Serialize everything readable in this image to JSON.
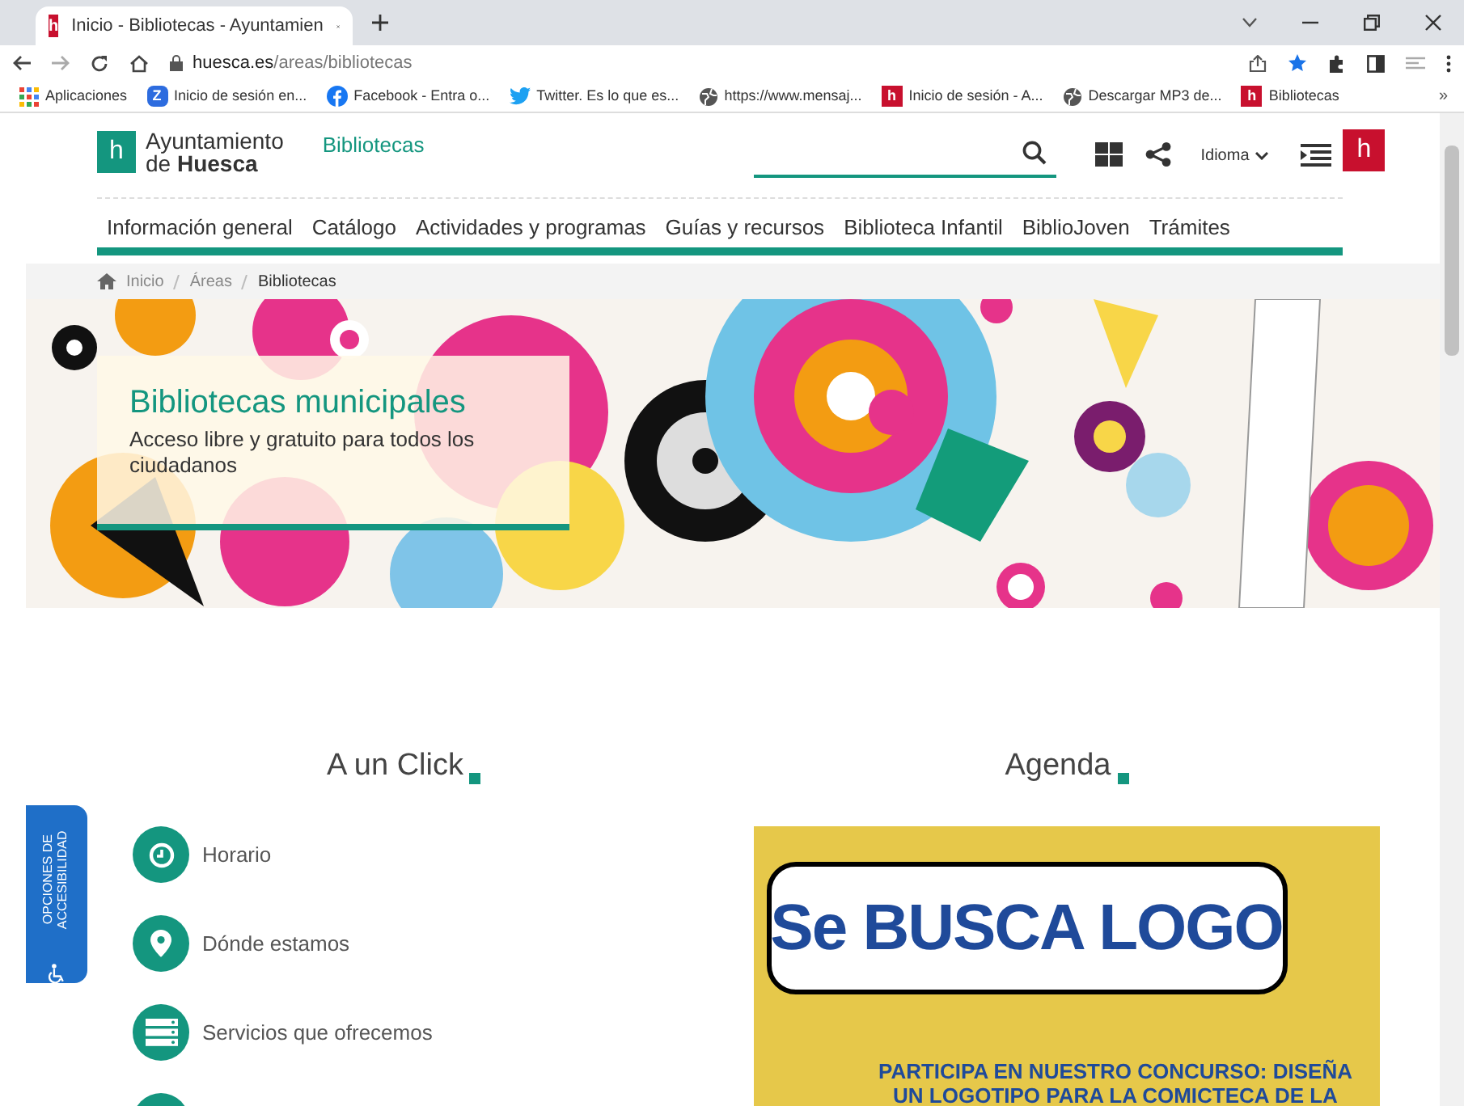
{
  "browser": {
    "tabs": [
      {
        "title": "Inicio - Bibliotecas - Ayuntamien",
        "favicon": "h",
        "selected": true
      }
    ],
    "url": {
      "host": "huesca.es",
      "path": "/areas/bibliotecas"
    },
    "bookmarks": [
      {
        "label": "Aplicaciones",
        "kind": "apps"
      },
      {
        "label": "Inicio de sesión en...",
        "kind": "letter",
        "favicon": "Z"
      },
      {
        "label": "Facebook - Entra o...",
        "kind": "facebook"
      },
      {
        "label": "Twitter. Es lo que es...",
        "kind": "twitter"
      },
      {
        "label": "https://www.mensaj...",
        "kind": "globe"
      },
      {
        "label": "Inicio de sesión - A...",
        "kind": "h",
        "favicon": "h"
      },
      {
        "label": "Descargar MP3 de...",
        "kind": "globe"
      },
      {
        "label": "Bibliotecas",
        "kind": "h",
        "favicon": "h"
      }
    ],
    "more": "»"
  },
  "site": {
    "logo": {
      "mark": "h",
      "line1": "Ayuntamiento",
      "line2_prefix": "de",
      "line2": "Huesca"
    },
    "section": "Bibliotecas",
    "language": "Idioma",
    "city_logo": "h",
    "nav": [
      "Información general",
      "Catálogo",
      "Actividades y programas",
      "Guías y recursos",
      "Biblioteca Infantil",
      "BiblioJoven",
      "Trámites"
    ],
    "breadcrumb": [
      "Inicio",
      "Áreas",
      "Bibliotecas"
    ],
    "hero": {
      "title": "Bibliotecas municipales",
      "subtitle": "Acceso libre y gratuito para todos los ciudadanos"
    },
    "quick_links": {
      "title": "A un Click",
      "items": [
        {
          "label": "Horario",
          "kind": "clock"
        },
        {
          "label": "Dónde estamos",
          "kind": "pin"
        },
        {
          "label": "Servicios que ofrecemos",
          "kind": "server"
        }
      ]
    },
    "agenda": {
      "title": "Agenda",
      "poster": {
        "headline": "Se BUSCA LOGO",
        "caption": "PARTICIPA EN NUESTRO CONCURSO: DISEÑA UN LOGOTIPO PARA LA COMICTECA DE LA"
      }
    },
    "accessibility": {
      "label": "OPCIONES DE ACCESIBILIDAD"
    }
  }
}
